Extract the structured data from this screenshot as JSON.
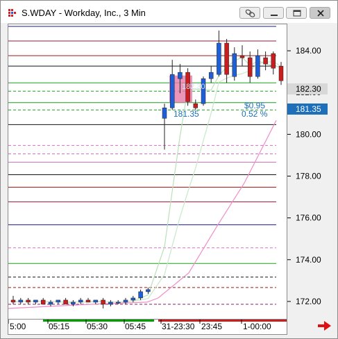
{
  "window": {
    "title": "S.WDAY - Workday, Inc., 3 Min",
    "buttons": {
      "link": "link-icon",
      "minimize": "minimize-icon",
      "maximize": "maximize-icon",
      "close": "close-icon"
    }
  },
  "price_axis": {
    "tick_labels": [
      "184.00",
      "182.00",
      "180.00",
      "178.00",
      "176.00",
      "174.00",
      "172.00"
    ],
    "last_price_badge": "182.30",
    "cursor_price_badge": "181.35"
  },
  "time_axis": {
    "labels": [
      "5:00",
      "05:15",
      "05:30",
      "05:45",
      "31-23:30",
      "23:45",
      "1-00:00"
    ]
  },
  "chart_annotations": {
    "change_label": "$0.95",
    "change_percent": "0.52 %",
    "cursor_price": "181.35",
    "faint_label": "182.30"
  },
  "colors": {
    "up_candle": "#1f5fd6",
    "down_candle": "#c81e1e",
    "last_price_badge": "#d8d8d8",
    "cursor_badge": "#1c6fb8",
    "selection_box": "#e77aa8",
    "scroll_arrow": "#e01010",
    "axis_highlight": "#00a000"
  },
  "chart_data": {
    "type": "candlestick",
    "title": "S.WDAY - Workday, Inc., 3 Min",
    "ylim": [
      171.2,
      185.3
    ],
    "x_labels": [
      "5:00",
      "05:15",
      "05:30",
      "05:45",
      "31-23:30",
      "23:45",
      "1-00:00"
    ],
    "candles": [
      {
        "o": 172.1,
        "h": 172.3,
        "l": 171.9,
        "c": 172.0
      },
      {
        "o": 172.0,
        "h": 172.2,
        "l": 171.9,
        "c": 172.1
      },
      {
        "o": 172.1,
        "h": 172.2,
        "l": 171.9,
        "c": 172.0
      },
      {
        "o": 172.0,
        "h": 172.1,
        "l": 171.9,
        "c": 172.1
      },
      {
        "o": 172.1,
        "h": 172.2,
        "l": 171.9,
        "c": 171.9
      },
      {
        "o": 171.9,
        "h": 172.1,
        "l": 171.8,
        "c": 172.0
      },
      {
        "o": 172.0,
        "h": 172.1,
        "l": 171.9,
        "c": 172.1
      },
      {
        "o": 172.1,
        "h": 172.2,
        "l": 171.9,
        "c": 171.9
      },
      {
        "o": 171.9,
        "h": 172.1,
        "l": 171.8,
        "c": 172.0
      },
      {
        "o": 172.0,
        "h": 172.2,
        "l": 171.9,
        "c": 172.1
      },
      {
        "o": 172.1,
        "h": 172.2,
        "l": 172.0,
        "c": 172.0
      },
      {
        "o": 172.0,
        "h": 172.1,
        "l": 171.9,
        "c": 172.1
      },
      {
        "o": 172.1,
        "h": 172.2,
        "l": 171.7,
        "c": 171.9
      },
      {
        "o": 171.9,
        "h": 172.1,
        "l": 171.8,
        "c": 172.0
      },
      {
        "o": 172.0,
        "h": 172.1,
        "l": 171.9,
        "c": 172.0
      },
      {
        "o": 172.0,
        "h": 172.2,
        "l": 171.9,
        "c": 172.1
      },
      {
        "o": 172.1,
        "h": 172.3,
        "l": 172.0,
        "c": 172.2
      },
      {
        "o": 172.2,
        "h": 172.6,
        "l": 172.1,
        "c": 172.5
      },
      {
        "o": 172.5,
        "h": 172.7,
        "l": 172.4,
        "c": 172.6
      },
      {
        "o": 180.8,
        "h": 181.5,
        "l": 179.3,
        "c": 181.3
      },
      {
        "o": 181.3,
        "h": 183.6,
        "l": 181.2,
        "c": 182.9
      },
      {
        "o": 182.7,
        "h": 183.4,
        "l": 182.0,
        "c": 183.0
      },
      {
        "o": 183.0,
        "h": 183.2,
        "l": 181.4,
        "c": 181.6
      },
      {
        "o": 181.5,
        "h": 181.7,
        "l": 181.2,
        "c": 181.3
      },
      {
        "o": 181.5,
        "h": 182.8,
        "l": 181.4,
        "c": 182.7
      },
      {
        "o": 182.7,
        "h": 183.3,
        "l": 182.5,
        "c": 183.0
      },
      {
        "o": 182.9,
        "h": 185.0,
        "l": 182.8,
        "c": 184.4
      },
      {
        "o": 184.4,
        "h": 184.6,
        "l": 182.5,
        "c": 182.9
      },
      {
        "o": 182.8,
        "h": 184.2,
        "l": 182.6,
        "c": 183.9
      },
      {
        "o": 183.8,
        "h": 184.3,
        "l": 183.3,
        "c": 183.7
      },
      {
        "o": 183.7,
        "h": 184.0,
        "l": 182.5,
        "c": 182.8
      },
      {
        "o": 182.8,
        "h": 184.1,
        "l": 182.7,
        "c": 183.8
      },
      {
        "o": 183.7,
        "h": 184.0,
        "l": 183.1,
        "c": 183.4
      },
      {
        "o": 183.9,
        "h": 184.0,
        "l": 182.9,
        "c": 183.2
      },
      {
        "o": 183.3,
        "h": 183.5,
        "l": 182.4,
        "c": 182.6
      }
    ],
    "reference_levels_pre_gap": [
      {
        "price": 185.2,
        "style": "solid",
        "color": "#1a1a9a"
      },
      {
        "price": 184.5,
        "style": "solid",
        "color": "#8b1a3a"
      },
      {
        "price": 183.8,
        "style": "solid",
        "color": "#a01818"
      },
      {
        "price": 183.3,
        "style": "solid",
        "color": "#111111"
      },
      {
        "price": 182.5,
        "style": "solid",
        "color": "#19a019"
      },
      {
        "price": 182.1,
        "style": "dashed",
        "color": "#19a019"
      },
      {
        "price": 181.55,
        "style": "solid",
        "color": "#19a019"
      },
      {
        "price": 181.2,
        "style": "dashed",
        "color": "#19a019"
      },
      {
        "price": 180.5,
        "style": "solid",
        "color": "#111111"
      },
      {
        "price": 179.5,
        "style": "dashed",
        "color": "#d870c0"
      },
      {
        "price": 179.1,
        "style": "dashed",
        "color": "#d870c0"
      },
      {
        "price": 178.7,
        "style": "solid",
        "color": "#d870c0"
      },
      {
        "price": 178.1,
        "style": "solid",
        "color": "#111111"
      },
      {
        "price": 177.5,
        "style": "solid",
        "color": "#b01818"
      },
      {
        "price": 176.8,
        "style": "solid",
        "color": "#8b1a3a"
      },
      {
        "price": 175.7,
        "style": "solid",
        "color": "#1a1a9a"
      },
      {
        "price": 174.6,
        "style": "dashed",
        "color": "#d870c0"
      },
      {
        "price": 173.85,
        "style": "solid",
        "color": "#19a019"
      },
      {
        "price": 173.2,
        "style": "dashed",
        "color": "#111111"
      },
      {
        "price": 172.7,
        "style": "dashed",
        "color": "#a01818"
      },
      {
        "price": 171.9,
        "style": "dashed",
        "color": "#8b1a6a"
      }
    ]
  }
}
